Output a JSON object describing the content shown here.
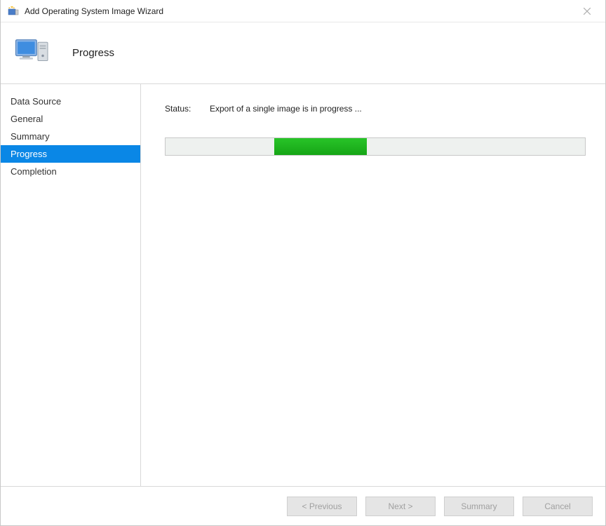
{
  "window": {
    "title": "Add Operating System Image Wizard"
  },
  "header": {
    "title": "Progress"
  },
  "sidebar": {
    "items": [
      {
        "label": "Data Source",
        "selected": false
      },
      {
        "label": "General",
        "selected": false
      },
      {
        "label": "Summary",
        "selected": false
      },
      {
        "label": "Progress",
        "selected": true
      },
      {
        "label": "Completion",
        "selected": false
      }
    ]
  },
  "content": {
    "status_label": "Status:",
    "status_text": "Export of a single image is in progress ...",
    "progress": {
      "offset_pct": 26,
      "width_pct": 22
    }
  },
  "footer": {
    "buttons": [
      {
        "label": "< Previous",
        "enabled": false
      },
      {
        "label": "Next >",
        "enabled": false
      },
      {
        "label": "Summary",
        "enabled": false
      },
      {
        "label": "Cancel",
        "enabled": false
      }
    ]
  },
  "colors": {
    "selection": "#0a87e6",
    "progress_green": "#16a516"
  }
}
